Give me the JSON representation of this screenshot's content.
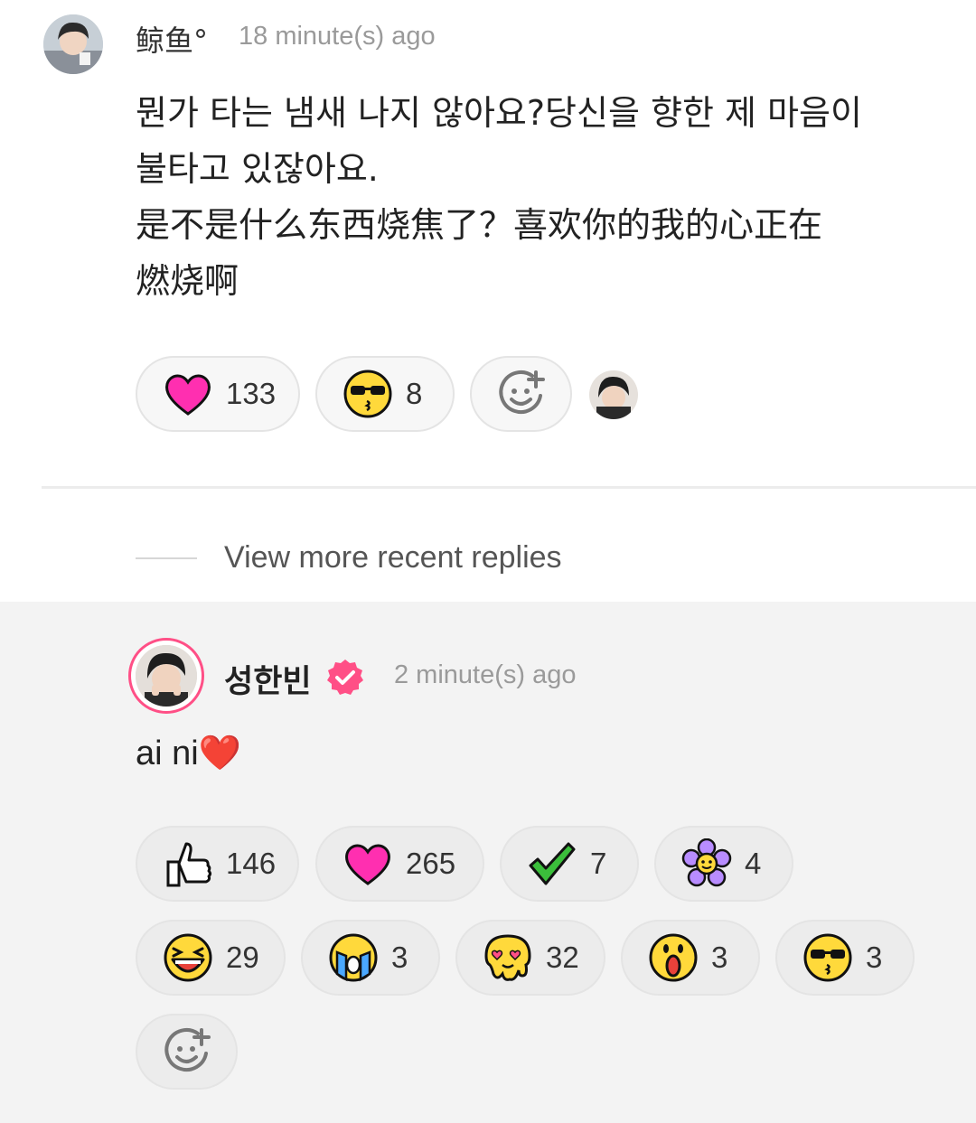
{
  "top_comment": {
    "username": "鲸鱼°",
    "time": "18 minute(s) ago",
    "text": "뭔가 타는 냄새 나지 않아요?당신을 향한 제 마음이\n불타고 있잖아요.\n是不是什么东西烧焦了？喜欢你的我的心正在\n燃烧啊",
    "reactions": [
      {
        "icon": "pink-heart-icon",
        "count": "133"
      },
      {
        "icon": "sunglasses-kiss-face-icon",
        "count": "8"
      }
    ]
  },
  "view_more": {
    "label": "View more recent replies"
  },
  "reply": {
    "username": "성한빈",
    "time": "2 minute(s) ago",
    "text": "ai ni❤️",
    "reactions": [
      {
        "icon": "thumbs-up-icon",
        "count": "146"
      },
      {
        "icon": "pink-heart-icon",
        "count": "265"
      },
      {
        "icon": "check-mark-icon",
        "count": "7"
      },
      {
        "icon": "purple-flower-icon",
        "count": "4"
      },
      {
        "icon": "laughing-face-icon",
        "count": "29"
      },
      {
        "icon": "crying-face-icon",
        "count": "3"
      },
      {
        "icon": "melting-heart-eyes-icon",
        "count": "32"
      },
      {
        "icon": "surprised-face-icon",
        "count": "3"
      },
      {
        "icon": "sunglasses-kiss-face-icon",
        "count": "3"
      }
    ]
  },
  "colors": {
    "accent_pink": "#ff4f86",
    "heart_pink": "#ff2fb0",
    "emoji_yellow": "#ffd93b"
  }
}
